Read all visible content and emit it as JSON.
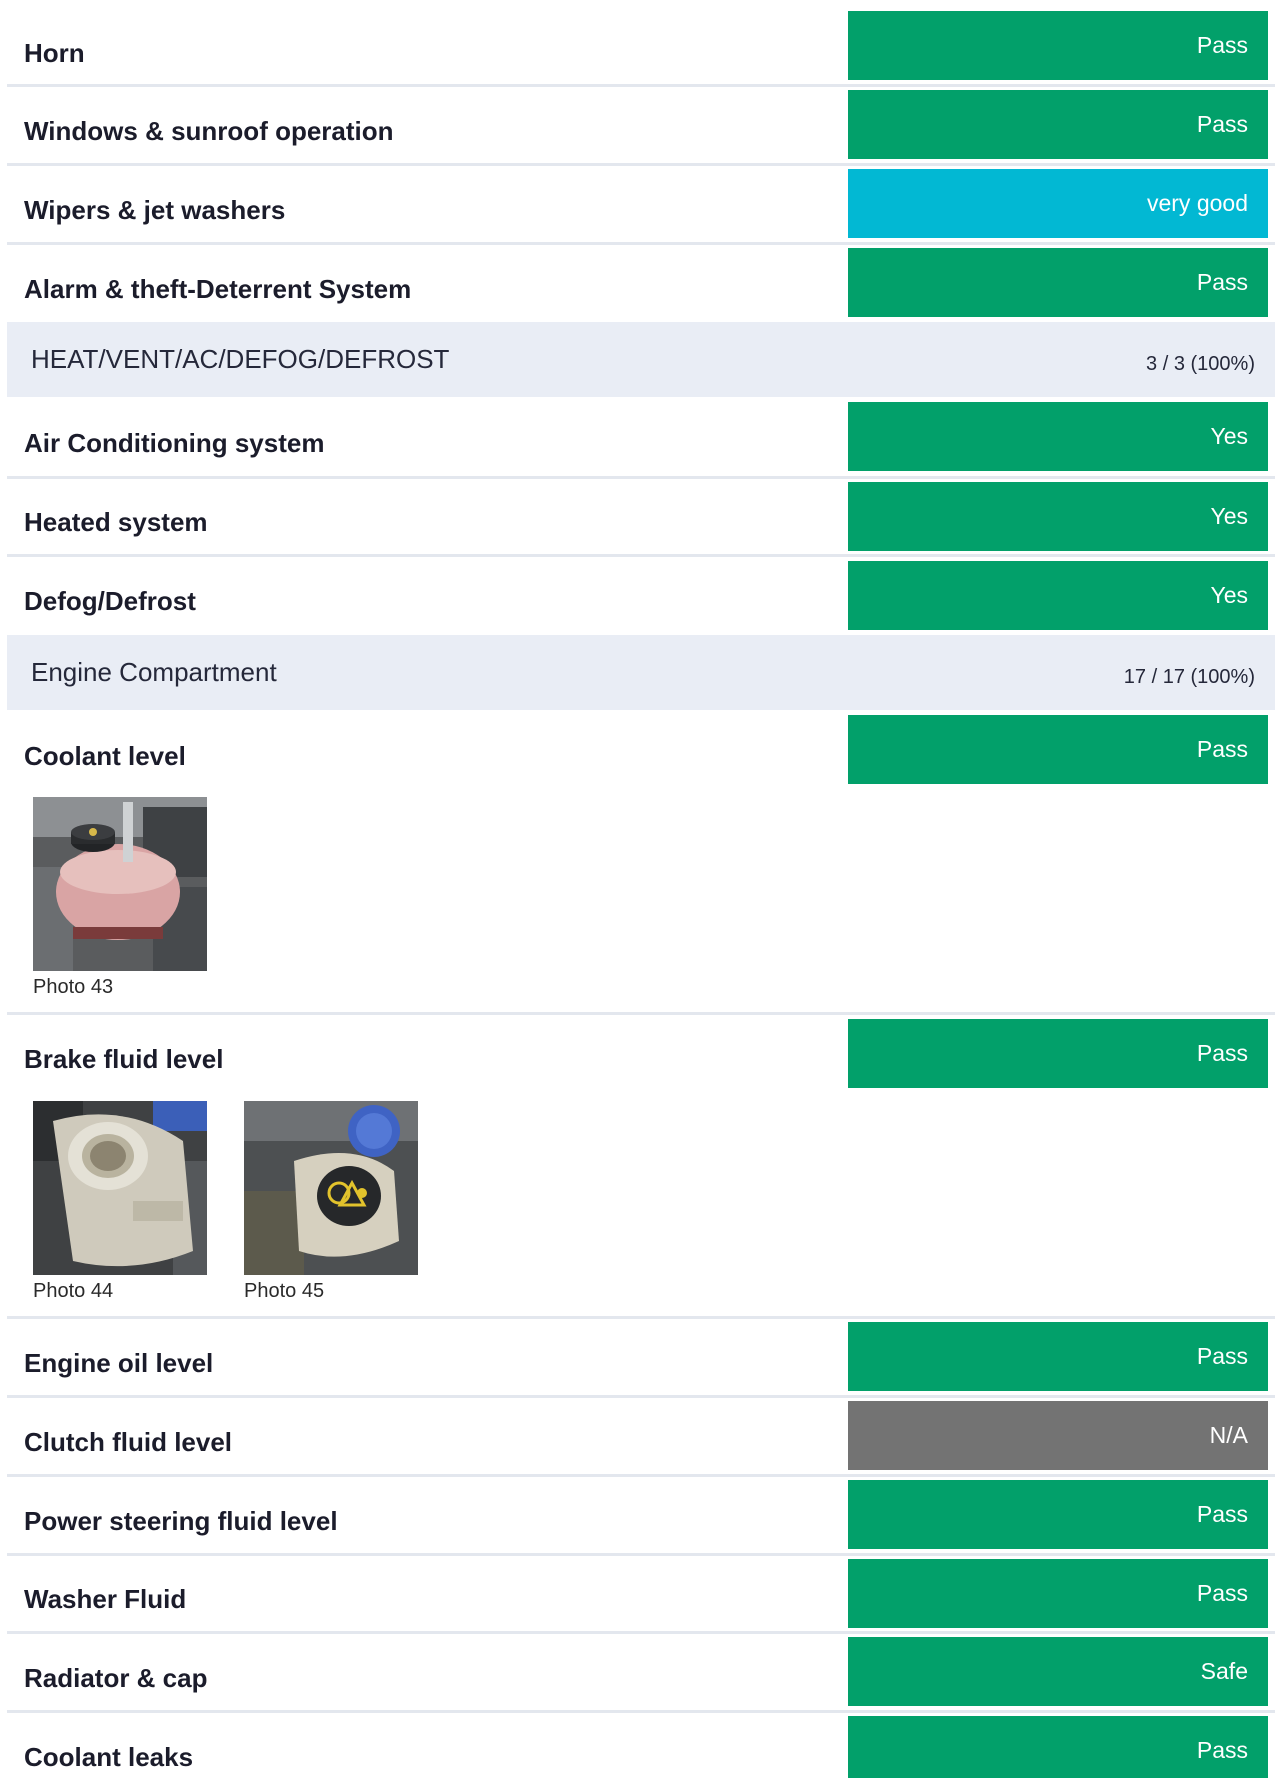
{
  "rows_top": [
    {
      "label": "Horn",
      "status": "Pass"
    },
    {
      "label": "Windows & sunroof operation",
      "status": "Pass"
    },
    {
      "label": "Wipers & jet washers",
      "status": "very good"
    },
    {
      "label": "Alarm & theft-Deterrent System",
      "status": "Pass"
    }
  ],
  "section_hvac": {
    "title": "HEAT/VENT/AC/DEFOG/DEFROST",
    "score": "3 / 3 (100%)"
  },
  "rows_hvac": [
    {
      "label": "Air Conditioning system",
      "status": "Yes"
    },
    {
      "label": "Heated system",
      "status": "Yes"
    },
    {
      "label": "Defog/Defrost",
      "status": "Yes"
    }
  ],
  "section_engine": {
    "title": "Engine Compartment",
    "score": "17 / 17 (100%)"
  },
  "coolant": {
    "label": "Coolant level",
    "status": "Pass",
    "photos": [
      "Photo 43"
    ]
  },
  "brake": {
    "label": "Brake fluid level",
    "status": "Pass",
    "photos": [
      "Photo 44",
      "Photo 45"
    ]
  },
  "rows_engine": [
    {
      "label": "Engine oil level",
      "status": "Pass"
    },
    {
      "label": "Clutch fluid level",
      "status": "N/A"
    },
    {
      "label": "Power steering fluid level",
      "status": "Pass"
    },
    {
      "label": "Washer Fluid",
      "status": "Pass"
    },
    {
      "label": "Radiator & cap",
      "status": "Safe"
    },
    {
      "label": "Coolant leaks",
      "status": "Pass"
    }
  ],
  "colors": {
    "pass": "#02a06a",
    "very_good": "#02b8d3",
    "na": "#737373",
    "section_bg": "#e9edf5"
  }
}
